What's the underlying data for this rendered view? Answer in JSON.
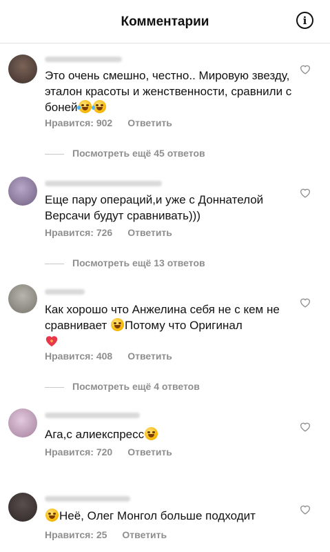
{
  "header": {
    "title": "Комментарии",
    "info_icon": "i"
  },
  "comments": [
    {
      "text": "Это очень смешно, честно.. Мировую звезду, эталон красоты и женственности, сравнили с боней",
      "emojis": [
        "rofl-emoji",
        "rofl-emoji"
      ],
      "likes": "Нравится: 902",
      "reply": "Ответить",
      "more_replies": "Посмотреть ещё 45 ответов",
      "avatar_color": "#5a4a44"
    },
    {
      "text": "Еще пару операций,и уже с Доннателой Версачи будут сравнивать)))",
      "emojis": [],
      "likes": "Нравится: 726",
      "reply": "Ответить",
      "more_replies": "Посмотреть ещё 13 ответов",
      "avatar_color": "#8a7d9c"
    },
    {
      "text": "Как хорошо что Анжелина себя не с кем не сравнивает",
      "text_after": "Потому что Оригинал",
      "emojis": [
        "tears-of-joy-emoji",
        "heart-on-fire-emoji"
      ],
      "likes": "Нравится: 408",
      "reply": "Ответить",
      "more_replies": "Посмотреть ещё 4 ответов",
      "avatar_color": "#9a9890"
    },
    {
      "text": "Ага,с алиекспресс",
      "emojis": [
        "tears-of-joy-emoji"
      ],
      "likes": "Нравится: 720",
      "reply": "Ответить",
      "avatar_color": "#c9a6c4"
    },
    {
      "text": "Неё,  Олег Монгол больше  подходит",
      "emojis": [
        "tears-of-joy-emoji"
      ],
      "likes": "Нравится: 25",
      "reply": "Ответить",
      "avatar_color": "#4a4040"
    }
  ],
  "colors": {
    "text": "#111111",
    "secondary": "#8e8e8e",
    "divider": "#e3e3e3"
  }
}
